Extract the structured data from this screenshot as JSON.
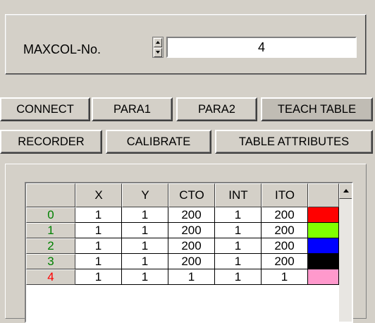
{
  "maxcol": {
    "label": "MAXCOL-No.",
    "value": "4"
  },
  "tabs_row1": [
    "CONNECT",
    "PARA1",
    "PARA2",
    "TEACH TABLE"
  ],
  "tabs_row2": [
    "RECORDER",
    "CALIBRATE",
    "TABLE ATTRIBUTES"
  ],
  "active_tab": "TEACH TABLE",
  "table": {
    "headers": [
      "X",
      "Y",
      "CTO",
      "INT",
      "ITO"
    ],
    "rows": [
      {
        "index": "0",
        "x": "1",
        "y": "1",
        "cto": "200",
        "int": "1",
        "ito": "200",
        "color": "#ff0000",
        "index_color": "#008000"
      },
      {
        "index": "1",
        "x": "1",
        "y": "1",
        "cto": "200",
        "int": "1",
        "ito": "200",
        "color": "#80ff00",
        "index_color": "#008000"
      },
      {
        "index": "2",
        "x": "1",
        "y": "1",
        "cto": "200",
        "int": "1",
        "ito": "200",
        "color": "#0000ff",
        "index_color": "#008000"
      },
      {
        "index": "3",
        "x": "1",
        "y": "1",
        "cto": "200",
        "int": "1",
        "ito": "200",
        "color": "#000000",
        "index_color": "#008000"
      },
      {
        "index": "4",
        "x": "1",
        "y": "1",
        "cto": "1",
        "int": "1",
        "ito": "1",
        "color": "#ff99cc",
        "index_color": "#ff0000"
      }
    ]
  }
}
